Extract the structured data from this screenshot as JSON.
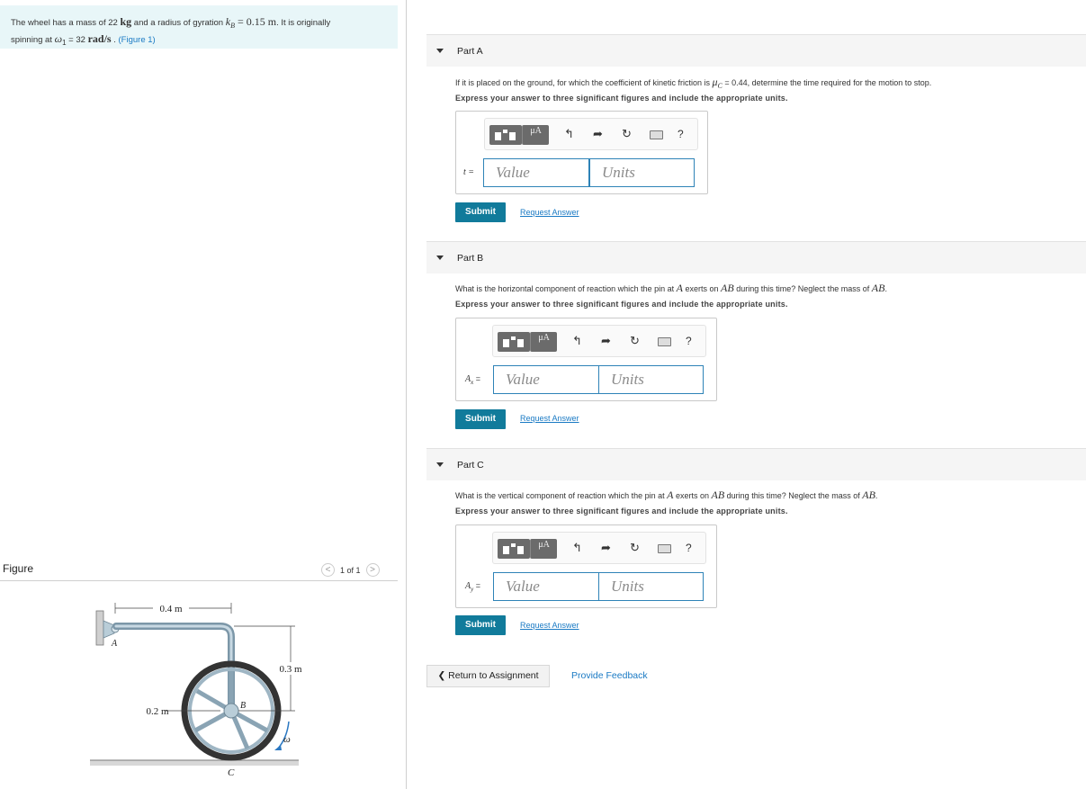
{
  "problem": {
    "text_1": "The wheel has a mass of 22 ",
    "mass_unit": "kg",
    "text_2": " and a radius of gyration ",
    "kB": "k",
    "kB_sub": "B",
    "kB_value": " = 0.15 m",
    "text_3": ". It is originally",
    "text_4": "spinning at ",
    "omega": "ω",
    "omega_sub": "1",
    "text_5": " = 32 ",
    "omega_unit": "rad/s",
    "text_6": " . ",
    "figure_link": "(Figure 1)"
  },
  "figure": {
    "title": "Figure",
    "pager": "1 of 1",
    "prev": "<",
    "next": ">",
    "labels": {
      "len_04": "0.4 m",
      "len_03": "0.3 m",
      "len_02": "0.2 m",
      "A": "A",
      "B": "B",
      "C": "C",
      "omega": "ω"
    }
  },
  "parts": [
    {
      "label": "Part A",
      "question_a": "If it is placed on the ground, for which the coefficient of kinetic friction is ",
      "question_mu": "μ",
      "question_mu_sub": "C",
      "question_b": " = 0.44, determine the time required for the motion to stop.",
      "instruction": "Express your answer to three significant figures and include the appropriate units.",
      "var": "t =",
      "value_placeholder": "Value",
      "units_placeholder": "Units",
      "submit": "Submit",
      "request": "Request Answer"
    },
    {
      "label": "Part B",
      "question_a": "What is the horizontal component of reaction which the pin at ",
      "q_A": "A",
      "question_b": " exerts on ",
      "q_AB": "AB",
      "question_c": " during this time? Neglect the mass of ",
      "q_AB2": "AB",
      "question_d": ".",
      "instruction": "Express your answer to three significant figures and include the appropriate units.",
      "var": "A",
      "var_sub": "x",
      "var_eq": " =",
      "value_placeholder": "Value",
      "units_placeholder": "Units",
      "submit": "Submit",
      "request": "Request Answer"
    },
    {
      "label": "Part C",
      "question_a": "What is the vertical component of reaction which the pin at ",
      "q_A": "A",
      "question_b": " exerts on ",
      "q_AB": "AB",
      "question_c": " during this time? Neglect the mass of ",
      "q_AB2": "AB",
      "question_d": ".",
      "instruction": "Express your answer to three significant figures and include the appropriate units.",
      "var": "A",
      "var_sub": "y",
      "var_eq": " =",
      "value_placeholder": "Value",
      "units_placeholder": "Units",
      "submit": "Submit",
      "request": "Request Answer"
    }
  ],
  "toolbar": {
    "mu_label": "μA",
    "help": "?"
  },
  "footer": {
    "return": "❮ Return to Assignment",
    "feedback": "Provide Feedback"
  }
}
